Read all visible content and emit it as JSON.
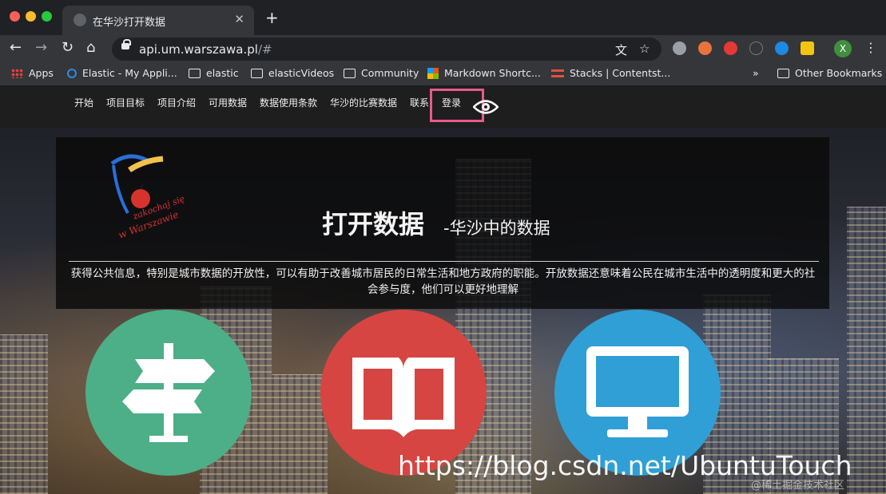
{
  "browser": {
    "tab_title": "在华沙打开数据",
    "url_host": "api.um.warszawa.pl",
    "url_rest": "/#",
    "new_tab": "+",
    "close_tab": "✕",
    "profile_initial": "X"
  },
  "bookmarks": {
    "items": [
      "Apps",
      "Elastic - My Appli...",
      "elastic",
      "elasticVideos",
      "Community",
      "Markdown Shortc...",
      "Stacks | Contentst..."
    ],
    "overflow": "»",
    "other": "Other Bookmarks"
  },
  "site_nav": {
    "links": [
      "开始",
      "项目目标",
      "项目介绍",
      "可用数据",
      "数据使用条款",
      "华沙的比赛数据",
      "联系",
      "登录"
    ],
    "highlight_color": "#e75a8c"
  },
  "hero": {
    "logo_text_1": "zakochaj się",
    "logo_text_2": "w Warszawie",
    "title": "打开数据",
    "subtitle": "-华沙中的数据",
    "description": "获得公共信息，特别是城市数据的开放性，可以有助于改善城市居民的日常生活和地方政府的职能。开放数据还意味着公民在城市生活中的透明度和更大的社会参与度，他们可以更好地理解"
  },
  "feature_icons": [
    {
      "icon": "signpost-icon",
      "color": "#4caf87"
    },
    {
      "icon": "open-book-icon",
      "color": "#d64541"
    },
    {
      "icon": "monitor-icon",
      "color": "#2f9fd6"
    }
  ],
  "watermark": {
    "url": "https://blog.csdn.net/UbuntuTouch",
    "tag": "@稀土掘金技术社区"
  }
}
